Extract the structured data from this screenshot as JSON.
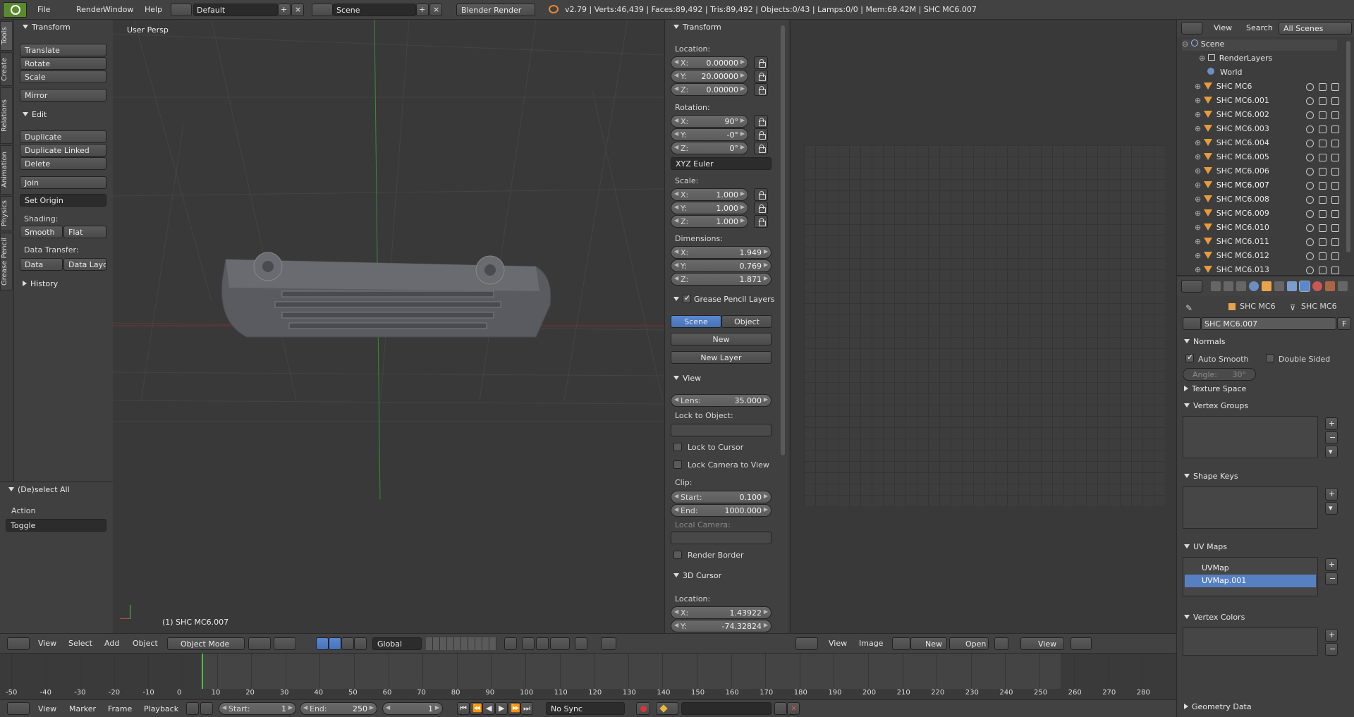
{
  "top": {
    "menus": [
      "File",
      "Render",
      "Window",
      "Help"
    ],
    "layout": "Default",
    "scene": "Scene",
    "engine": "Blender Render",
    "stats": "v2.79 | Verts:46,439 | Faces:89,492 | Tris:89,492 | Objects:0/43 | Lamps:0/0 | Mem:69.42M | SHC MC6.007"
  },
  "vtabs": [
    "Tools",
    "Create",
    "Relations",
    "Animation",
    "Physics",
    "Grease Pencil"
  ],
  "tools": {
    "transform_h": "Transform",
    "translate": "Translate",
    "rotate": "Rotate",
    "scale": "Scale",
    "mirror": "Mirror",
    "edit_h": "Edit",
    "duplicate": "Duplicate",
    "duplicate_linked": "Duplicate Linked",
    "delete": "Delete",
    "join": "Join",
    "set_origin": "Set Origin",
    "shading": "Shading:",
    "smooth": "Smooth",
    "flat": "Flat",
    "data_transfer": "Data Transfer:",
    "data": "Data",
    "data_layo": "Data Layo",
    "history": "History"
  },
  "operator": {
    "title": "(De)select All",
    "action_label": "Action",
    "action_value": "Toggle"
  },
  "viewport": {
    "label": "User Persp",
    "object": "(1) SHC MC6.007"
  },
  "props": {
    "transform_h": "Transform",
    "location": "Location:",
    "loc": [
      [
        "X:",
        "0.00000"
      ],
      [
        "Y:",
        "20.00000"
      ],
      [
        "Z:",
        "0.00000"
      ]
    ],
    "rotation": "Rotation:",
    "rot": [
      [
        "X:",
        "90°"
      ],
      [
        "Y:",
        "-0°"
      ],
      [
        "Z:",
        "0°"
      ]
    ],
    "rot_mode": "XYZ Euler",
    "scale": "Scale:",
    "scl": [
      [
        "X:",
        "1.000"
      ],
      [
        "Y:",
        "1.000"
      ],
      [
        "Z:",
        "1.000"
      ]
    ],
    "dimensions": "Dimensions:",
    "dim": [
      [
        "X:",
        "1.949"
      ],
      [
        "Y:",
        "0.769"
      ],
      [
        "Z:",
        "1.871"
      ]
    ],
    "gp_h": "Grease Pencil Layers",
    "gp_scene": "Scene",
    "gp_object": "Object",
    "gp_new": "New",
    "gp_newlayer": "New Layer",
    "view_h": "View",
    "lens_l": "Lens:",
    "lens_v": "35.000",
    "lock_obj": "Lock to Object:",
    "lock_cursor": "Lock to Cursor",
    "lock_cam": "Lock Camera to View",
    "clip": "Clip:",
    "clip_start_l": "Start:",
    "clip_start_v": "0.100",
    "clip_end_l": "End:",
    "clip_end_v": "1000.000",
    "local_cam": "Local Camera:",
    "render_border": "Render Border",
    "cursor_h": "3D Cursor",
    "cursor_loc": "Location:",
    "cur": [
      [
        "X:",
        "1.43922"
      ],
      [
        "Y:",
        "-74.32824"
      ]
    ]
  },
  "v3dheader": {
    "view": "View",
    "select": "Select",
    "add": "Add",
    "object": "Object",
    "mode": "Object Mode",
    "orient": "Global"
  },
  "imgheader": {
    "view": "View",
    "image": "Image",
    "new": "New",
    "open": "Open",
    "view2": "View"
  },
  "outliner": {
    "view": "View",
    "search": "Search",
    "scenes": "All Scenes",
    "scene": "Scene",
    "renderlayers": "RenderLayers",
    "world": "World",
    "objects": [
      "SHC MC6",
      "SHC MC6.001",
      "SHC MC6.002",
      "SHC MC6.003",
      "SHC MC6.004",
      "SHC MC6.005",
      "SHC MC6.006",
      "SHC MC6.007",
      "SHC MC6.008",
      "SHC MC6.009",
      "SHC MC6.010",
      "SHC MC6.011",
      "SHC MC6.012",
      "SHC MC6.013"
    ]
  },
  "mesh": {
    "crumb1": "SHC MC6",
    "crumb2": "SHC MC6",
    "name": "SHC MC6.007",
    "f": "F",
    "normals": "Normals",
    "auto_smooth": "Auto Smooth",
    "double_sided": "Double Sided",
    "angle": "Angle:",
    "angle_v": "30°",
    "texture_space": "Texture Space",
    "vertex_groups": "Vertex Groups",
    "shape_keys": "Shape Keys",
    "uv_maps": "UV Maps",
    "uv": [
      "UVMap",
      "UVMap.001"
    ],
    "vertex_colors": "Vertex Colors",
    "geometry_data": "Geometry Data"
  },
  "timeline": {
    "ticks": [
      "-50",
      "-40",
      "-30",
      "-20",
      "-10",
      "0",
      "10",
      "20",
      "30",
      "40",
      "50",
      "60",
      "70",
      "80",
      "90",
      "100",
      "110",
      "120",
      "130",
      "140",
      "150",
      "160",
      "170",
      "180",
      "190",
      "200",
      "210",
      "220",
      "230",
      "240",
      "250",
      "260",
      "270",
      "280"
    ],
    "view": "View",
    "marker": "Marker",
    "frame": "Frame",
    "playback": "Playback",
    "start_l": "Start:",
    "start_v": "1",
    "end_l": "End:",
    "end_v": "250",
    "current": "1",
    "sync": "No Sync"
  }
}
